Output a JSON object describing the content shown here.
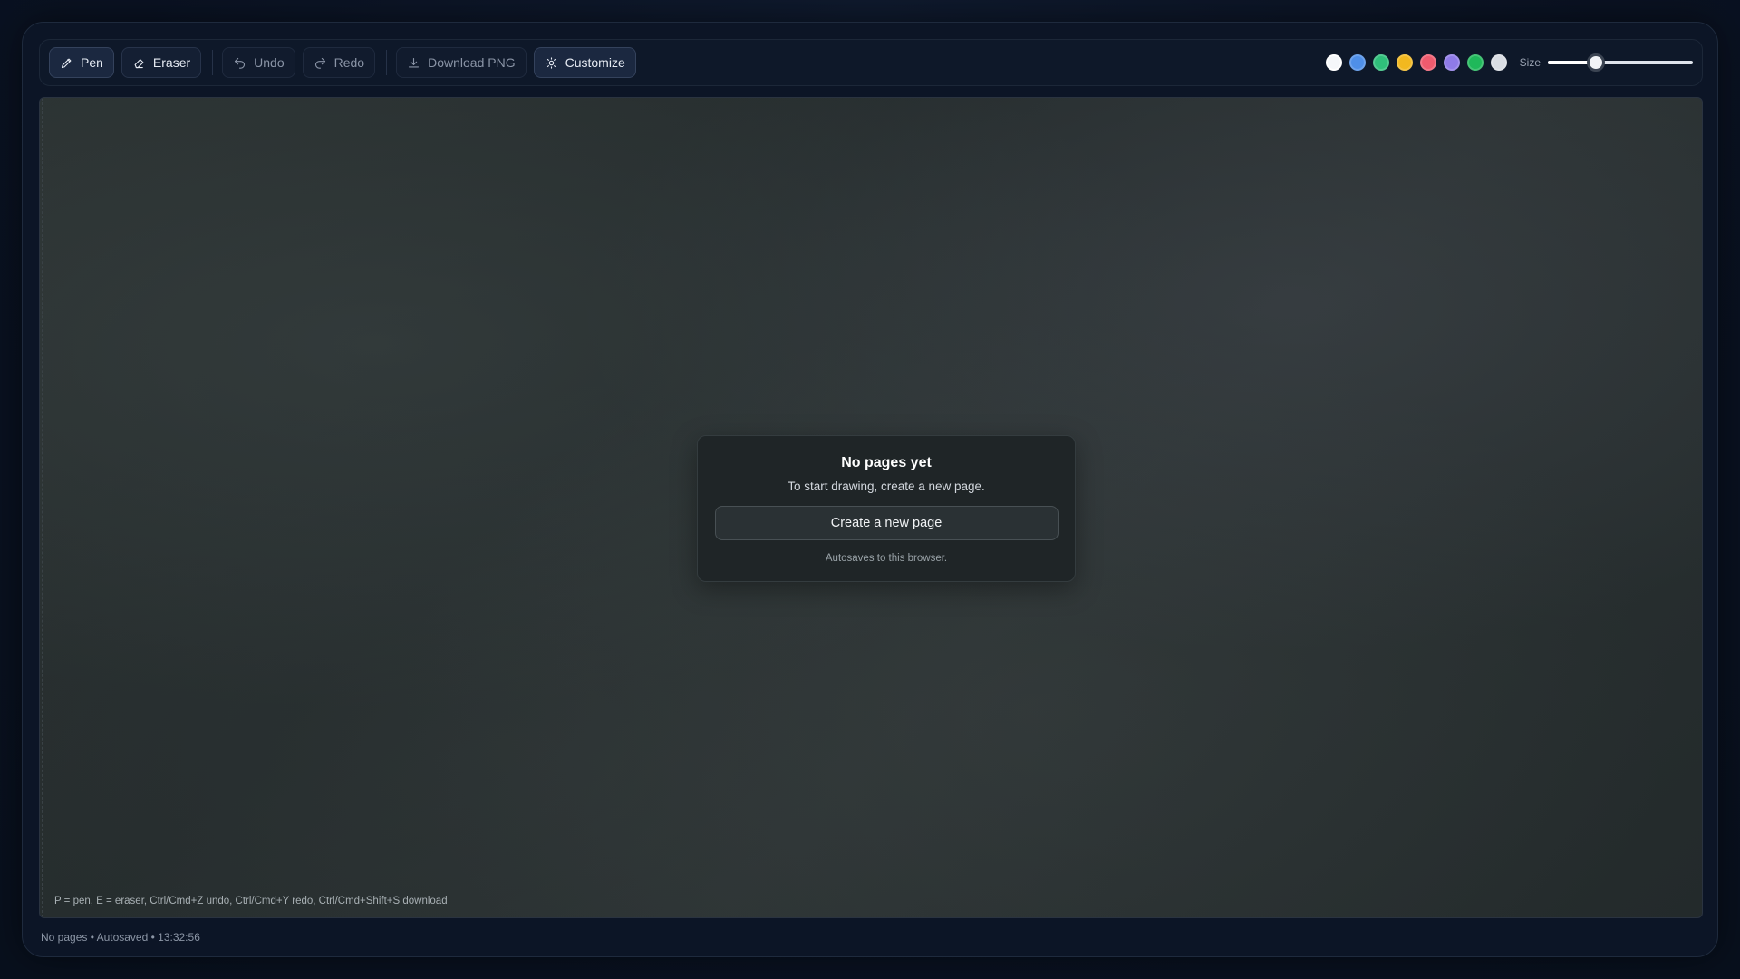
{
  "toolbar": {
    "pen_label": "Pen",
    "eraser_label": "Eraser",
    "undo_label": "Undo",
    "redo_label": "Redo",
    "download_label": "Download PNG",
    "customize_label": "Customize",
    "size_label": "Size",
    "size_value_fraction": 0.33,
    "swatches": [
      {
        "name": "white",
        "color": "#f5f7fa",
        "selected": true
      },
      {
        "name": "blue",
        "color": "#4f8fe8",
        "selected": false
      },
      {
        "name": "green",
        "color": "#2fbf7a",
        "selected": false
      },
      {
        "name": "yellow",
        "color": "#f2b81f",
        "selected": false
      },
      {
        "name": "red",
        "color": "#ef5b6e",
        "selected": false
      },
      {
        "name": "purple",
        "color": "#8f7be8",
        "selected": false
      },
      {
        "name": "bright-green",
        "color": "#1fb85a",
        "selected": false
      },
      {
        "name": "light-gray",
        "color": "#d9dde3",
        "selected": false
      }
    ]
  },
  "empty_state": {
    "title": "No pages yet",
    "subtitle": "To start drawing, create a new page.",
    "button_label": "Create a new page",
    "note": "Autosaves to this browser."
  },
  "canvas": {
    "shortcuts_hint": "P = pen, E = eraser, Ctrl/Cmd+Z undo, Ctrl/Cmd+Y redo, Ctrl/Cmd+Shift+S download"
  },
  "status_bar": {
    "text": "No pages • Autosaved • 13:32:56"
  }
}
